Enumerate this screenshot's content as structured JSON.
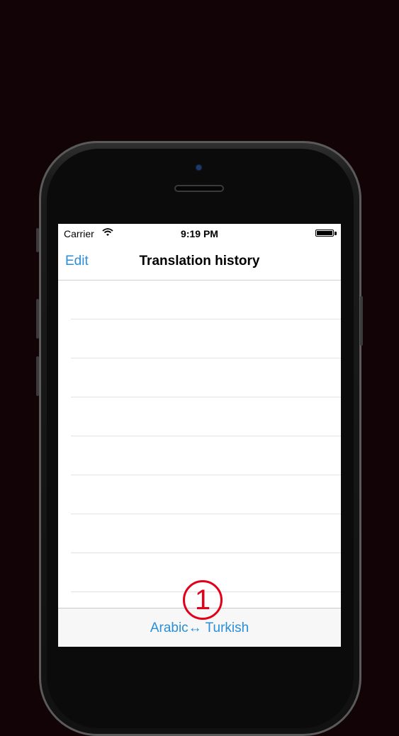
{
  "status_bar": {
    "carrier": "Carrier",
    "time": "9:19 PM"
  },
  "nav": {
    "edit_label": "Edit",
    "title": "Translation history"
  },
  "history": {
    "rows": [
      "",
      "",
      "",
      "",
      "",
      "",
      "",
      ""
    ]
  },
  "toolbar": {
    "language_pair": "Arabic↔ Turkish"
  },
  "annotation": {
    "step_number": "1"
  },
  "colors": {
    "accent": "#2a8fd6",
    "annotation_red": "#e3001b",
    "background": "#120306"
  }
}
